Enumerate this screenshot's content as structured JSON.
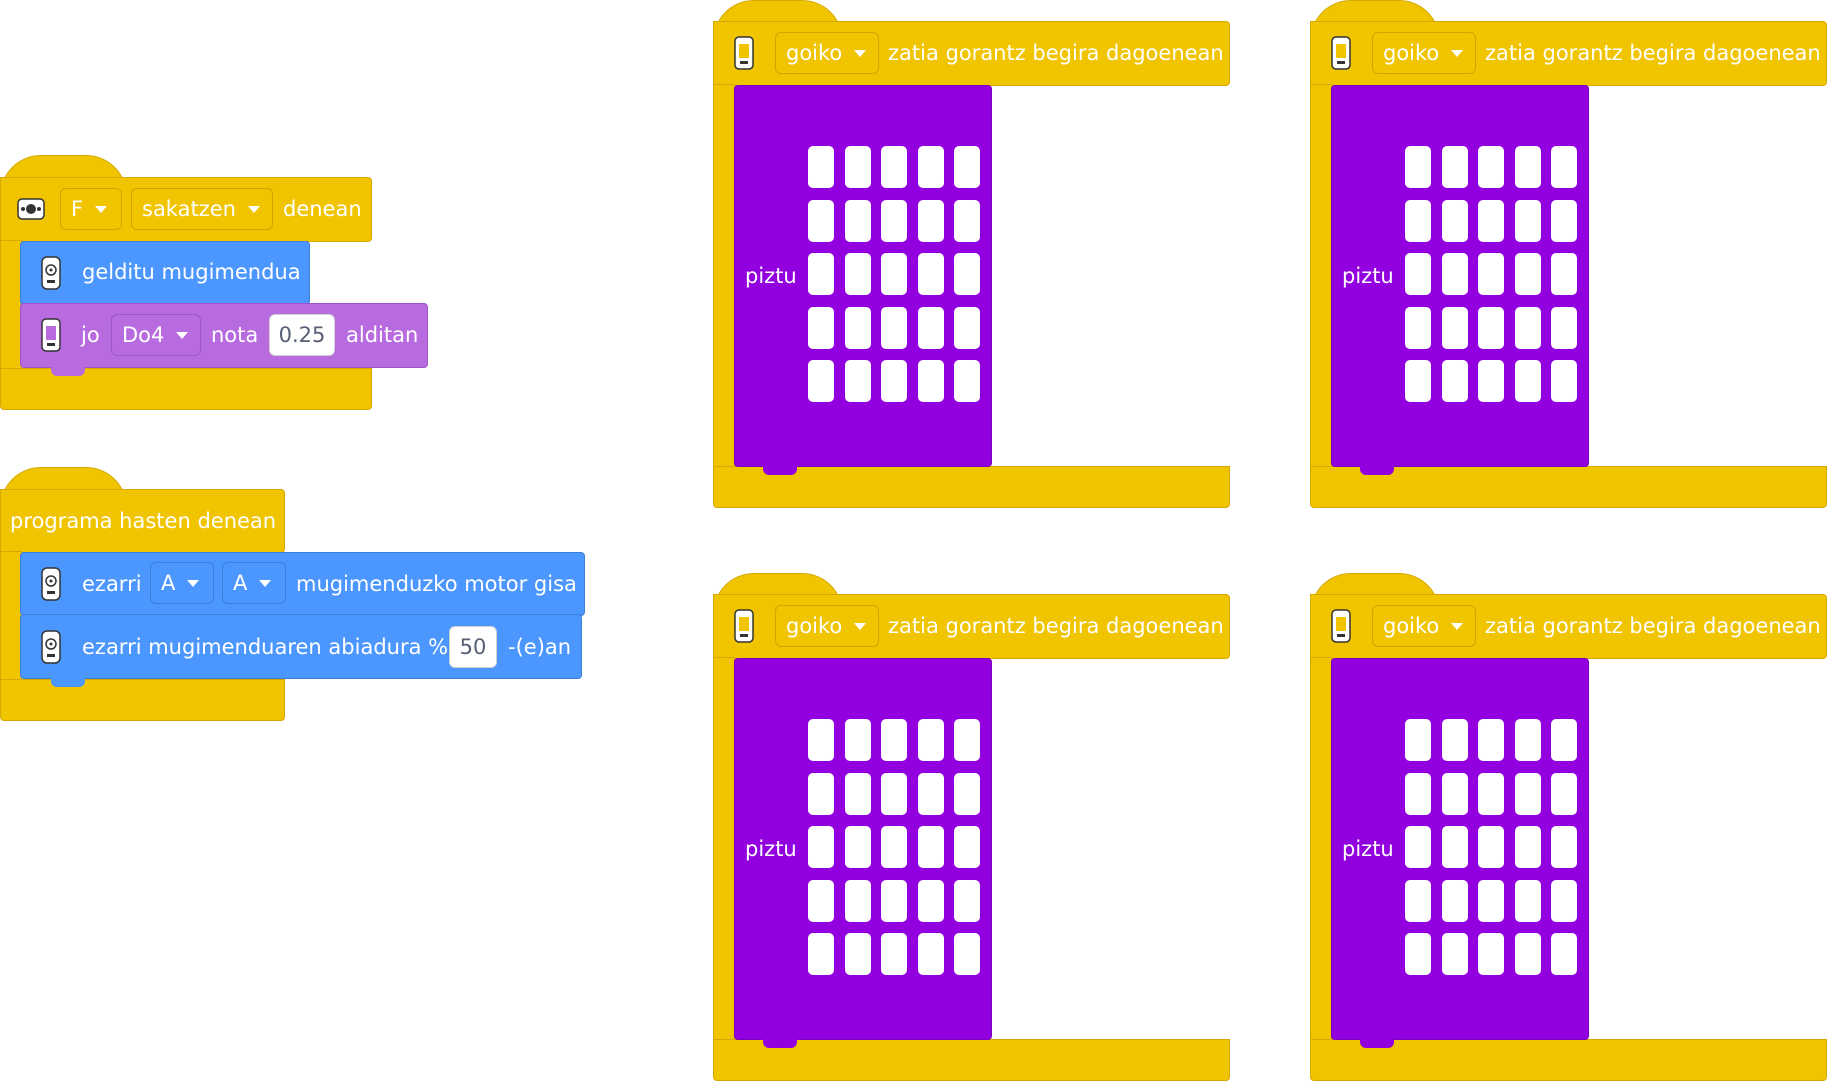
{
  "colors": {
    "events": "#f1c400",
    "motion": "#4c97ff",
    "sound": "#b86bdf",
    "display": "#9300e0",
    "led_on": "#ffffff"
  },
  "button_block": {
    "icon": "button-icon",
    "button_value": "F",
    "action_value": "sakatzen",
    "suffix": "denean",
    "stop": {
      "icon": "motor-icon",
      "label": "gelditu mugimendua"
    },
    "play": {
      "icon": "microbit-icon",
      "prefix": "jo",
      "note_value": "Do4",
      "middle": "nota",
      "beats_value": "0.25",
      "suffix": "alditan"
    }
  },
  "start_block": {
    "label": "programa hasten denean",
    "set_motor": {
      "icon": "motor-icon",
      "prefix": "ezarri",
      "port_1": "A",
      "port_2": "A",
      "suffix": "mugimenduzko motor gisa"
    },
    "set_speed": {
      "icon": "motor-icon",
      "prefix": "ezarri mugimenduaren abiadura %",
      "speed_value": "50",
      "suffix": "-(e)an"
    }
  },
  "gesture_blocks": [
    {
      "icon": "microbit-icon",
      "orientation_value": "goiko",
      "suffix": "zatia gorantz begira dagoenean",
      "display_label": "piztu"
    },
    {
      "icon": "microbit-icon",
      "orientation_value": "goiko",
      "suffix": "zatia gorantz begira dagoenean",
      "display_label": "piztu"
    },
    {
      "icon": "microbit-icon",
      "orientation_value": "goiko",
      "suffix": "zatia gorantz begira dagoenean",
      "display_label": "piztu"
    },
    {
      "icon": "microbit-icon",
      "orientation_value": "goiko",
      "suffix": "zatia gorantz begira dagoenean",
      "display_label": "piztu"
    }
  ]
}
